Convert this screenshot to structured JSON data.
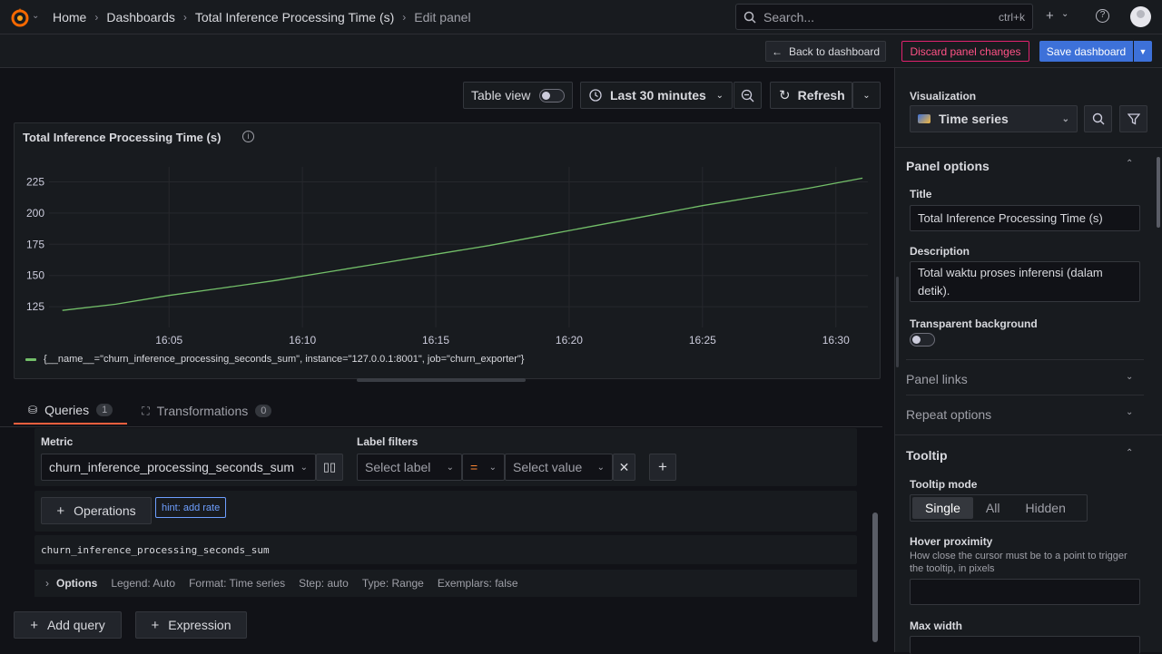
{
  "breadcrumbs": [
    "Home",
    "Dashboards",
    "Total Inference Processing Time (s)",
    "Edit panel"
  ],
  "search": {
    "placeholder": "Search...",
    "shortcut": "ctrl+k"
  },
  "actions": {
    "back": "Back to dashboard",
    "discard": "Discard panel changes",
    "save": "Save dashboard"
  },
  "toolbar": {
    "table_view": "Table view",
    "time_range": "Last 30 minutes",
    "refresh": "Refresh"
  },
  "panel": {
    "title": "Total Inference Processing Time (s)",
    "legend": "{__name__=\"churn_inference_processing_seconds_sum\", instance=\"127.0.0.1:8001\", job=\"churn_exporter\"}"
  },
  "chart_data": {
    "type": "line",
    "x_ticks": [
      "16:05",
      "16:10",
      "16:15",
      "16:20",
      "16:25",
      "16:30"
    ],
    "y_ticks": [
      125,
      150,
      175,
      200,
      225
    ],
    "ylim": [
      112,
      237
    ],
    "series": [
      {
        "name": "{__name__=\"churn_inference_processing_seconds_sum\", instance=\"127.0.0.1:8001\", job=\"churn_exporter\"}",
        "color": "#73bf69",
        "x": [
          "16:01",
          "16:03",
          "16:05",
          "16:07",
          "16:09",
          "16:11",
          "16:13",
          "16:15",
          "16:17",
          "16:19",
          "16:21",
          "16:23",
          "16:25",
          "16:27",
          "16:29",
          "16:31"
        ],
        "values": [
          122,
          127,
          134,
          140,
          146,
          153,
          160,
          167,
          174,
          182,
          190,
          198,
          206,
          213,
          220,
          228
        ]
      }
    ]
  },
  "tabs": [
    {
      "label": "Queries",
      "count": "1"
    },
    {
      "label": "Transformations",
      "count": "0"
    }
  ],
  "query": {
    "metric_label": "Metric",
    "metric_value": "churn_inference_processing_seconds_sum",
    "label_filters_label": "Label filters",
    "select_label": "Select label",
    "operator": "=",
    "select_value": "Select value",
    "operations": "Operations",
    "hint": "hint: add rate",
    "raw": "churn_inference_processing_seconds_sum",
    "options_label": "Options",
    "options": [
      "Legend: Auto",
      "Format: Time series",
      "Step: auto",
      "Type: Range",
      "Exemplars: false"
    ]
  },
  "bottom": {
    "add_query": "Add query",
    "expression": "Expression"
  },
  "side": {
    "visualization_label": "Visualization",
    "visualization": "Time series",
    "panel_options": "Panel options",
    "title_label": "Title",
    "title_value": "Total Inference Processing Time (s)",
    "description_label": "Description",
    "description_value": "Total waktu proses inferensi (dalam detik).",
    "transparent_label": "Transparent background",
    "panel_links": "Panel links",
    "repeat_options": "Repeat options",
    "tooltip": "Tooltip",
    "tooltip_mode_label": "Tooltip mode",
    "tooltip_modes": [
      "Single",
      "All",
      "Hidden"
    ],
    "hover_label": "Hover proximity",
    "hover_desc": "How close the cursor must be to a point to trigger the tooltip, in pixels",
    "max_width_label": "Max width"
  }
}
